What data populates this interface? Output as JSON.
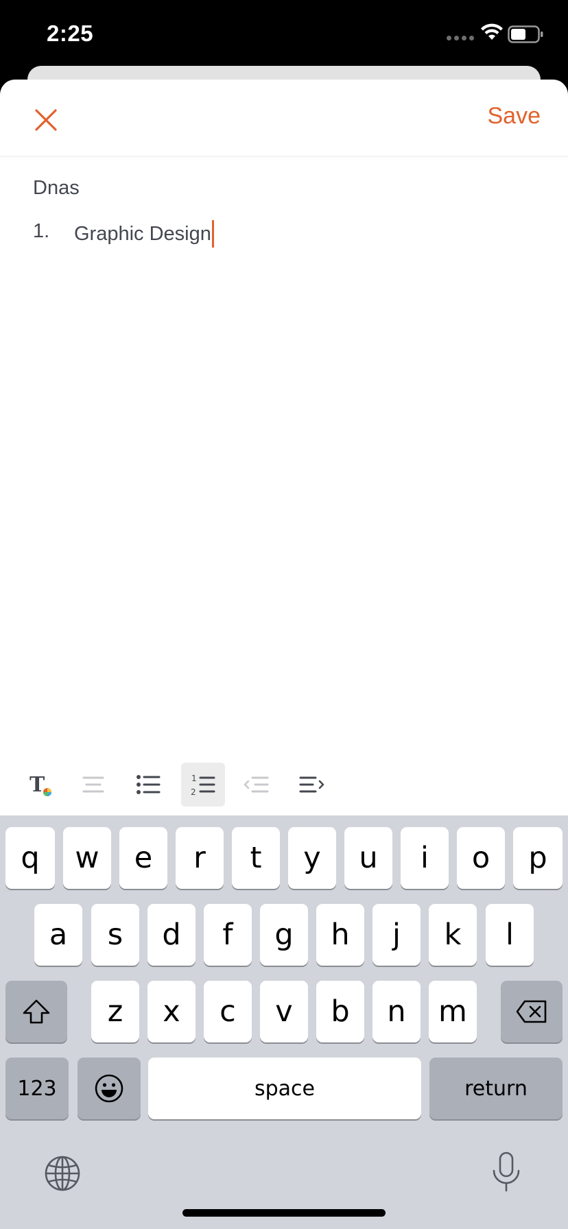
{
  "status_bar": {
    "time": "2:25"
  },
  "header": {
    "save_label": "Save"
  },
  "editor": {
    "heading": "Dnas",
    "list_items": [
      {
        "number": "1.",
        "text": "Graphic Design"
      }
    ]
  },
  "toolbar": {
    "buttons": [
      "text-style-icon",
      "align-icon",
      "bullet-list-icon",
      "numbered-list-icon",
      "outdent-icon",
      "indent-icon"
    ],
    "active": "numbered-list-icon"
  },
  "keyboard": {
    "row1": [
      "q",
      "w",
      "e",
      "r",
      "t",
      "y",
      "u",
      "i",
      "o",
      "p"
    ],
    "row2": [
      "a",
      "s",
      "d",
      "f",
      "g",
      "h",
      "j",
      "k",
      "l"
    ],
    "row3": [
      "z",
      "x",
      "c",
      "v",
      "b",
      "n",
      "m"
    ],
    "numbers_key": "123",
    "space_key": "space",
    "return_key": "return"
  },
  "colors": {
    "accent": "#e2622c",
    "keyboard_bg": "#d1d4da",
    "text": "#44474f"
  }
}
